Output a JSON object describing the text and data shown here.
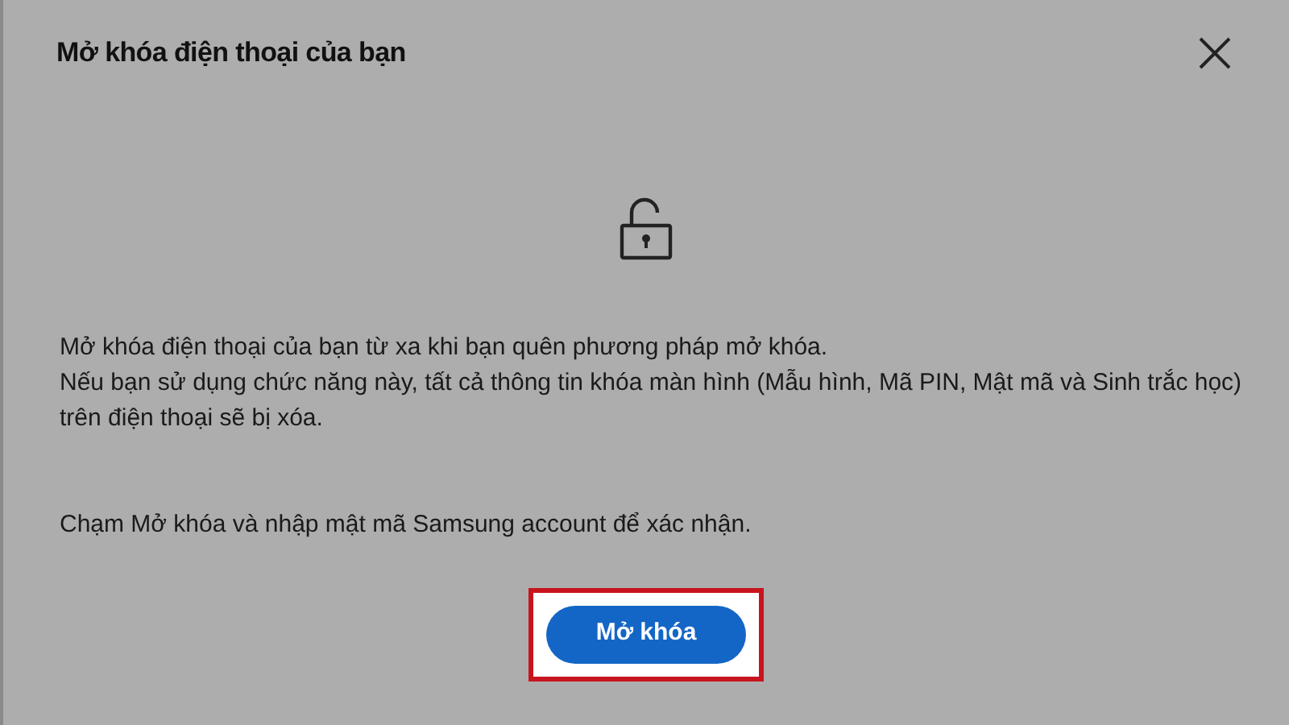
{
  "dialog": {
    "title": "Mở khóa điện thoại của bạn",
    "paragraphs": [
      "Mở khóa điện thoại của bạn từ xa khi bạn quên phương pháp mở khóa.",
      "Nếu bạn sử dụng chức năng này, tất cả thông tin khóa màn hình (Mẫu hình, Mã PIN, Mật mã và Sinh trắc học) trên điện thoại sẽ bị xóa.",
      "Chạm Mở khóa và nhập mật mã Samsung account để xác nhận."
    ],
    "button": {
      "label": "Mở khóa",
      "highlighted": true
    }
  }
}
